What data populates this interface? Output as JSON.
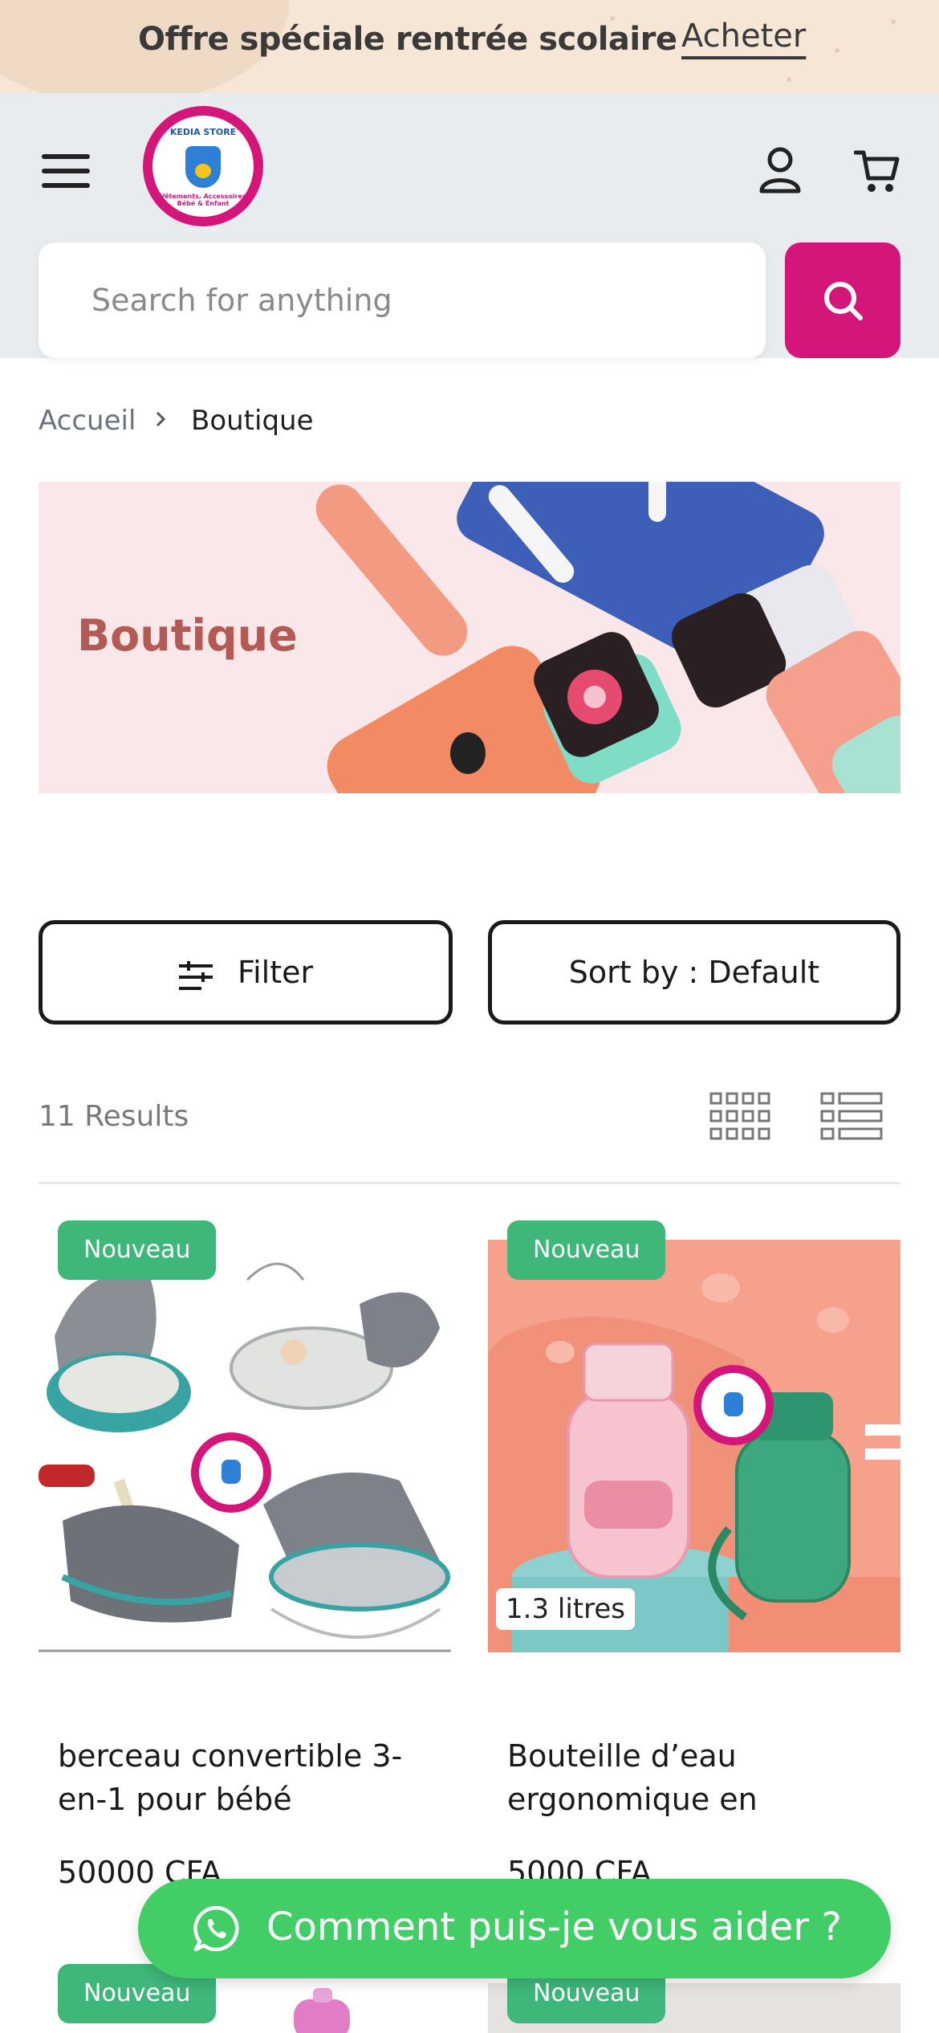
{
  "promo": {
    "text": "Offre spéciale rentrée scolaire",
    "link": "Acheter"
  },
  "header": {
    "logo_text": "KEDIA STORE",
    "logo_subtext": "Vêtements, Accessoires Bébé & Enfant",
    "search_placeholder": "Search for anything"
  },
  "breadcrumb": {
    "home": "Accueil",
    "current": "Boutique"
  },
  "banner": {
    "title": "Boutique"
  },
  "toolbar": {
    "filter_label": "Filter",
    "sort_label": "Sort by :  Default",
    "results": "11 Results"
  },
  "products": [
    {
      "badge": "Nouveau",
      "title": "berceau convertible 3-en-1 pour bébé",
      "price": "50000 CFA"
    },
    {
      "badge": "Nouveau",
      "title": "Bouteille d’eau ergonomique en",
      "price": "5000 CFA",
      "image_label": "1.3 litres"
    },
    {
      "badge": "Nouveau"
    },
    {
      "badge": "Nouveau"
    }
  ],
  "whatsapp": {
    "label": "Comment puis-je vous aider ?"
  },
  "colors": {
    "accent": "#d4157a",
    "badge": "#3fb67a",
    "whatsapp": "#43cd66"
  }
}
